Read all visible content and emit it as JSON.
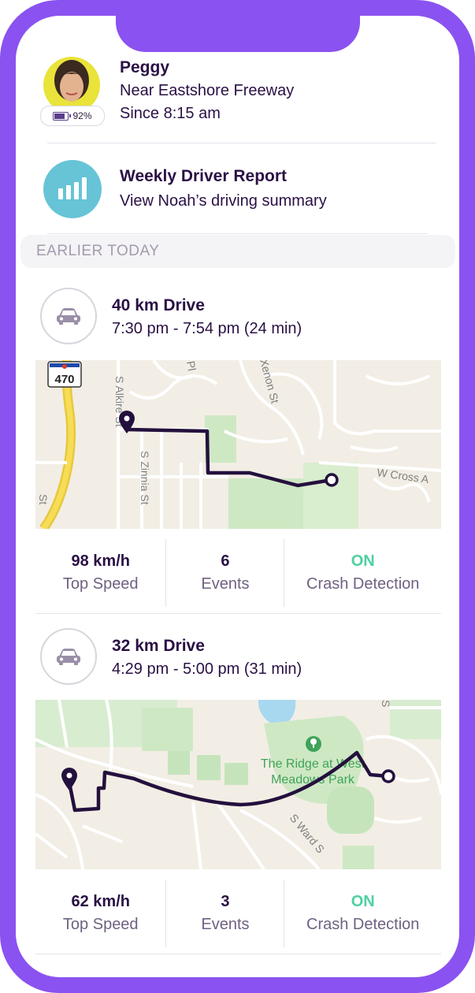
{
  "header": {
    "person_name": "Peggy",
    "location": "Near Eastshore Freeway",
    "since": "Since 8:15 am",
    "battery": "92%"
  },
  "report": {
    "title": "Weekly Driver Report",
    "subtitle": "View Noah’s driving summary"
  },
  "section_label": "EARLIER TODAY",
  "drives": [
    {
      "title": "40 km Drive",
      "time": "7:30 pm - 7:54 pm (24 min)",
      "map_labels": {
        "highway": "470",
        "street1": "S Alkire St",
        "street2": "S Zinnia St",
        "street3": "Xenon St",
        "street4": "W Cross A",
        "street5": "Pl",
        "street6": "St"
      },
      "top_speed": "98 km/h",
      "top_speed_label": "Top Speed",
      "events": "6",
      "events_label": "Events",
      "crash": "ON",
      "crash_label": "Crash Detection"
    },
    {
      "title": "32 km Drive",
      "time": "4:29 pm - 5:00 pm (31 min)",
      "map_labels": {
        "park1": "The Ridge at West",
        "park2": "Meadows Park",
        "street1": "S Ward S",
        "street2": "S"
      },
      "top_speed": "62 km/h",
      "top_speed_label": "Top Speed",
      "events": "3",
      "events_label": "Events",
      "crash": "ON",
      "crash_label": "Crash Detection"
    }
  ],
  "colors": {
    "frame": "#8a52f0",
    "text_dark": "#2a1045",
    "accent_on": "#4fd0a0",
    "route": "#24103d"
  }
}
